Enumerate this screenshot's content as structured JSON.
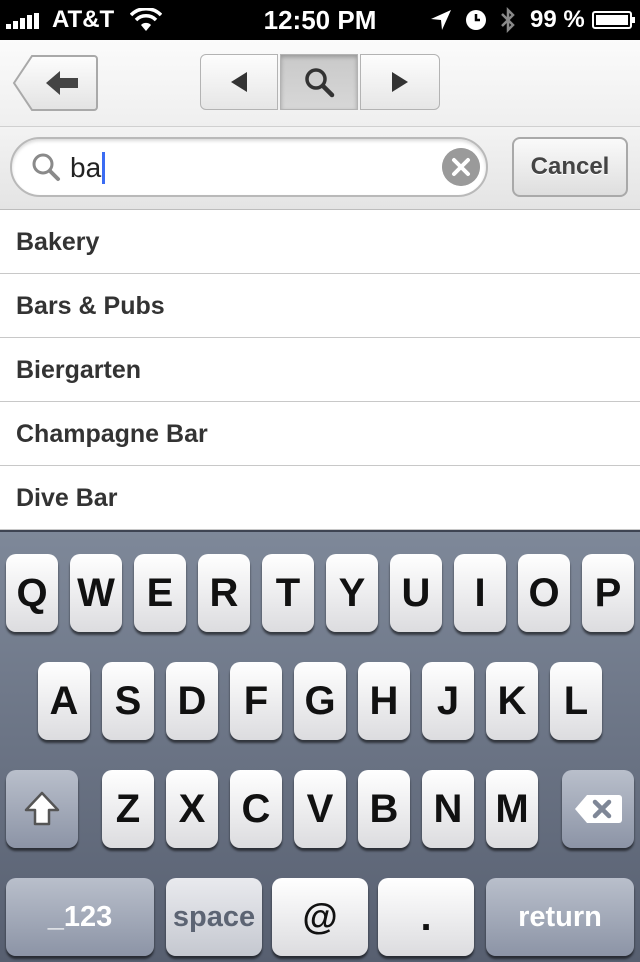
{
  "status_bar": {
    "carrier": "AT&T",
    "time": "12:50 PM",
    "battery_percent": "99 %",
    "icons": [
      "signal-icon",
      "wifi-icon",
      "location-icon",
      "alarm-icon",
      "bluetooth-icon",
      "battery-icon"
    ]
  },
  "nav": {
    "back_icon": "back-arrow-icon",
    "segments": [
      "prev-icon",
      "search-icon",
      "next-icon"
    ]
  },
  "search": {
    "value": "ba",
    "cancel_label": "Cancel",
    "caret_color": "#3b6cf3"
  },
  "results": [
    "Bakery",
    "Bars & Pubs",
    "Biergarten",
    "Champagne Bar",
    "Dive Bar"
  ],
  "keyboard": {
    "row1": [
      "Q",
      "W",
      "E",
      "R",
      "T",
      "Y",
      "U",
      "I",
      "O",
      "P"
    ],
    "row2": [
      "A",
      "S",
      "D",
      "F",
      "G",
      "H",
      "J",
      "K",
      "L"
    ],
    "row3": [
      "Z",
      "X",
      "C",
      "V",
      "B",
      "N",
      "M"
    ],
    "shift_icon": "shift-icon",
    "delete_icon": "delete-icon",
    "numbers_label": "_123",
    "space_label": "space",
    "at_label": "@",
    "dot_label": ".",
    "return_label": "return"
  }
}
